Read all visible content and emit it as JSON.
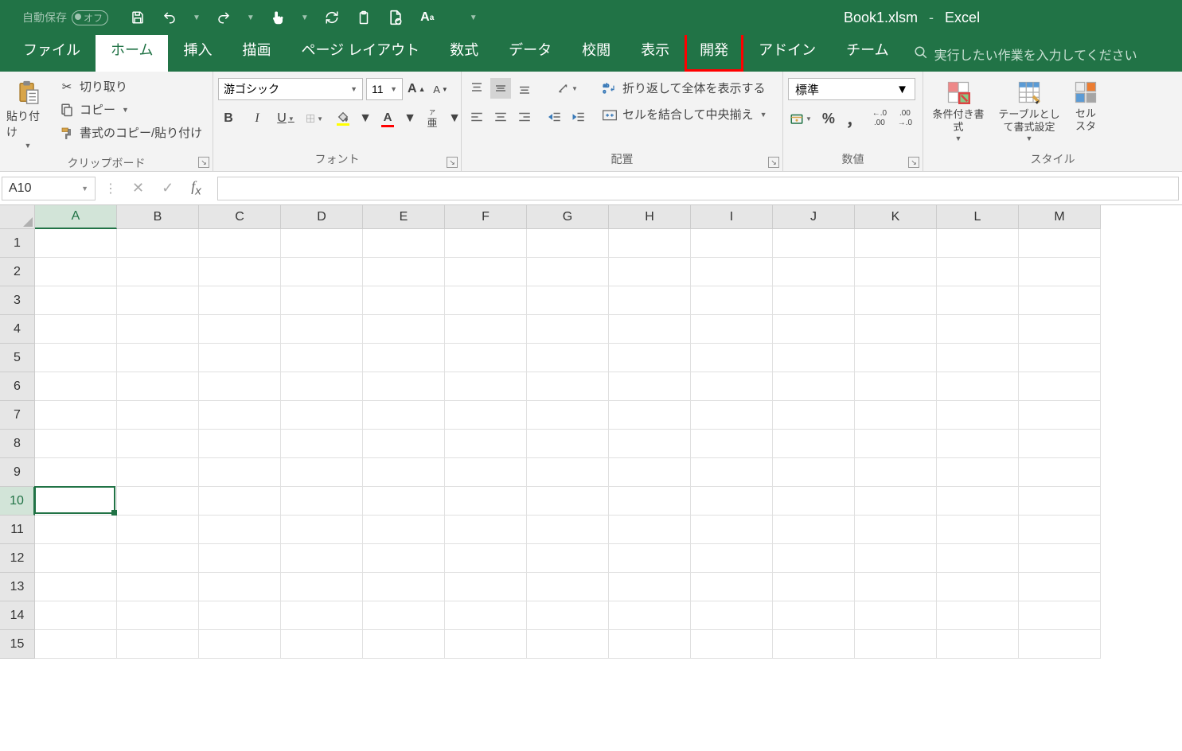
{
  "titlebar": {
    "autosave_label": "自動保存",
    "autosave_state": "オフ",
    "filename": "Book1.xlsm",
    "dash": "-",
    "app_name": "Excel"
  },
  "tabs": {
    "items": [
      {
        "label": "ファイル",
        "active": false,
        "highlight": false
      },
      {
        "label": "ホーム",
        "active": true,
        "highlight": false
      },
      {
        "label": "挿入",
        "active": false,
        "highlight": false
      },
      {
        "label": "描画",
        "active": false,
        "highlight": false
      },
      {
        "label": "ページ レイアウト",
        "active": false,
        "highlight": false
      },
      {
        "label": "数式",
        "active": false,
        "highlight": false
      },
      {
        "label": "データ",
        "active": false,
        "highlight": false
      },
      {
        "label": "校閲",
        "active": false,
        "highlight": false
      },
      {
        "label": "表示",
        "active": false,
        "highlight": false
      },
      {
        "label": "開発",
        "active": false,
        "highlight": true
      },
      {
        "label": "アドイン",
        "active": false,
        "highlight": false
      },
      {
        "label": "チーム",
        "active": false,
        "highlight": false
      }
    ],
    "search_placeholder": "実行したい作業を入力してください"
  },
  "ribbon": {
    "clipboard": {
      "paste": "貼り付け",
      "cut": "切り取り",
      "copy": "コピー",
      "format_painter": "書式のコピー/貼り付け",
      "group_label": "クリップボード"
    },
    "font": {
      "font_name": "游ゴシック",
      "font_size": "11",
      "bold": "B",
      "italic": "I",
      "underline": "U",
      "ruby": "ア亜",
      "group_label": "フォント"
    },
    "alignment": {
      "wrap_text": "折り返して全体を表示する",
      "merge_center": "セルを結合して中央揃え",
      "group_label": "配置"
    },
    "number": {
      "format": "標準",
      "percent": "%",
      "comma": "，",
      "group_label": "数値"
    },
    "styles": {
      "conditional": "条件付き書式",
      "table": "テーブルとして書式設定",
      "cell_styles_1": "セル",
      "cell_styles_2": "スタ",
      "group_label": "スタイル"
    }
  },
  "formula_bar": {
    "name_box": "A10",
    "formula": ""
  },
  "grid": {
    "columns": [
      "A",
      "B",
      "C",
      "D",
      "E",
      "F",
      "G",
      "H",
      "I",
      "J",
      "K",
      "L",
      "M"
    ],
    "rows": [
      1,
      2,
      3,
      4,
      5,
      6,
      7,
      8,
      9,
      10,
      11,
      12,
      13,
      14,
      15
    ],
    "selected_col_index": 0,
    "selected_row_index": 9,
    "selected_cell": "A10"
  }
}
